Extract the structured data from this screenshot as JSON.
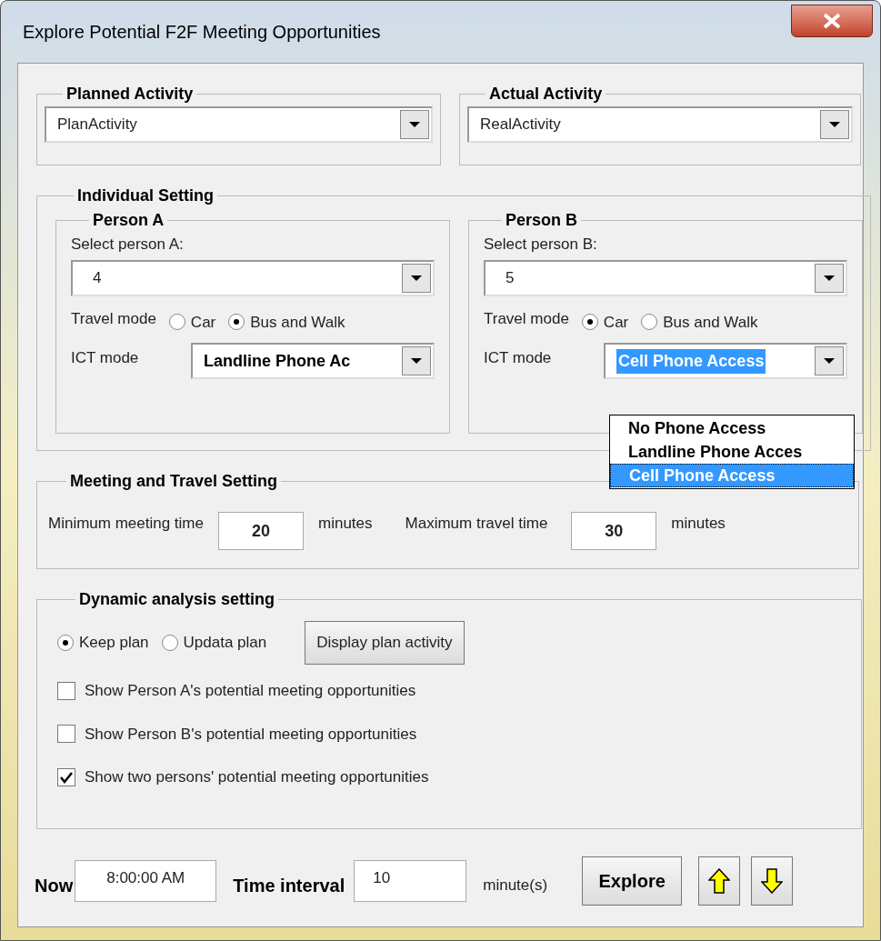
{
  "window": {
    "title": "Explore Potential F2F Meeting Opportunities"
  },
  "activities": [
    {
      "label": "Planned Activity",
      "value": "PlanActivity"
    },
    {
      "label": "Actual Activity",
      "value": "RealActivity"
    }
  ],
  "individual_setting": {
    "label": "Individual Setting",
    "persons": [
      {
        "label": "Person A",
        "select_label": "Select person A:",
        "value": "4",
        "travel_mode_label": "Travel mode",
        "travel_modes": [
          {
            "label": "Car",
            "selected": false
          },
          {
            "label": "Bus and Walk",
            "selected": true
          }
        ],
        "ict_label": "ICT mode",
        "ict_value": "Landline Phone Ac",
        "ict_highlighted": false
      },
      {
        "label": "Person B",
        "select_label": "Select person B:",
        "value": "5",
        "travel_mode_label": "Travel mode",
        "travel_modes": [
          {
            "label": "Car",
            "selected": true
          },
          {
            "label": "Bus and Walk",
            "selected": false
          }
        ],
        "ict_label": "ICT mode",
        "ict_value": "Cell Phone Access",
        "ict_highlighted": true,
        "ict_options": [
          {
            "label": "No Phone Access",
            "selected": false
          },
          {
            "label": "Landline Phone Acces",
            "selected": false
          },
          {
            "label": "Cell Phone Access",
            "selected": true
          }
        ]
      }
    ]
  },
  "meeting_travel": {
    "label": "Meeting and Travel Setting",
    "min_label": "Minimum meeting time",
    "min_value": "20",
    "min_unit": "minutes",
    "max_label": "Maximum travel time",
    "max_value": "30",
    "max_unit": "minutes"
  },
  "dynamic": {
    "label": "Dynamic analysis setting",
    "plan_options": [
      {
        "label": "Keep plan",
        "selected": true
      },
      {
        "label": "Updata plan",
        "selected": false
      }
    ],
    "button": "Display plan activity",
    "checkboxes": [
      {
        "label": "Show Person A's potential meeting opportunities",
        "checked": false
      },
      {
        "label": "Show Person B's potential meeting opportunities",
        "checked": false
      },
      {
        "label": "Show two persons' potential meeting opportunities",
        "checked": true
      }
    ]
  },
  "footer": {
    "now_label": "Now",
    "now_value": "8:00:00 AM",
    "interval_label": "Time interval",
    "interval_value": "10",
    "interval_unit": "minute(s)",
    "explore": "Explore"
  }
}
